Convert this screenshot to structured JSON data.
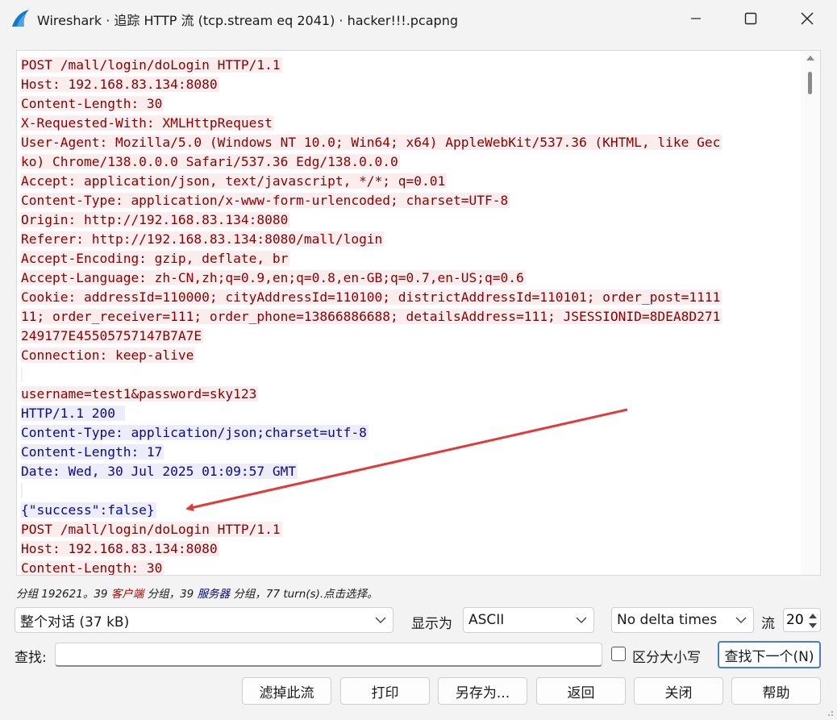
{
  "window": {
    "title": "Wireshark · 追踪 HTTP 流 (tcp.stream eq 2041) · hacker!!!.pcapng"
  },
  "stream_lines": [
    {
      "dir": "client",
      "text": "POST /mall/login/doLogin HTTP/1.1"
    },
    {
      "dir": "client",
      "text": "Host: 192.168.83.134:8080"
    },
    {
      "dir": "client",
      "text": "Content-Length: 30"
    },
    {
      "dir": "client",
      "text": "X-Requested-With: XMLHttpRequest"
    },
    {
      "dir": "client",
      "text": "User-Agent: Mozilla/5.0 (Windows NT 10.0; Win64; x64) AppleWebKit/537.36 (KHTML, like Gec"
    },
    {
      "dir": "client",
      "text": "ko) Chrome/138.0.0.0 Safari/537.36 Edg/138.0.0.0"
    },
    {
      "dir": "client",
      "text": "Accept: application/json, text/javascript, */*; q=0.01"
    },
    {
      "dir": "client",
      "text": "Content-Type: application/x-www-form-urlencoded; charset=UTF-8"
    },
    {
      "dir": "client",
      "text": "Origin: http://192.168.83.134:8080"
    },
    {
      "dir": "client",
      "text": "Referer: http://192.168.83.134:8080/mall/login"
    },
    {
      "dir": "client",
      "text": "Accept-Encoding: gzip, deflate, br"
    },
    {
      "dir": "client",
      "text": "Accept-Language: zh-CN,zh;q=0.9,en;q=0.8,en-GB;q=0.7,en-US;q=0.6"
    },
    {
      "dir": "client",
      "text": "Cookie: addressId=110000; cityAddressId=110100; districtAddressId=110101; order_post=1111"
    },
    {
      "dir": "client",
      "text": "11; order_receiver=111; order_phone=13866886688; detailsAddress=111; JSESSIONID=8DEA8D271"
    },
    {
      "dir": "client",
      "text": "249177E45505757147B7A7E"
    },
    {
      "dir": "client",
      "text": "Connection: keep-alive"
    },
    {
      "dir": "client",
      "text": ""
    },
    {
      "dir": "client",
      "text": "username=test1&password=sky123"
    },
    {
      "dir": "server",
      "text": "HTTP/1.1 200 "
    },
    {
      "dir": "server",
      "text": "Content-Type: application/json;charset=utf-8"
    },
    {
      "dir": "server",
      "text": "Content-Length: 17"
    },
    {
      "dir": "server",
      "text": "Date: Wed, 30 Jul 2025 01:09:57 GMT"
    },
    {
      "dir": "server",
      "text": ""
    },
    {
      "dir": "server",
      "text": "{\"success\":false}"
    },
    {
      "dir": "client",
      "text": "POST /mall/login/doLogin HTTP/1.1"
    },
    {
      "dir": "client",
      "text": "Host: 192.168.83.134:8080"
    },
    {
      "dir": "client",
      "text": "Content-Length: 30"
    }
  ],
  "colors": {
    "client_text": "#8b0000",
    "client_bg": "#fbeded",
    "server_text": "#0a0a8b",
    "server_bg": "#ececfb",
    "annotation_arrow": "#e03a3a"
  },
  "status": {
    "prefix": "分组 192621。39 ",
    "client_link": "客户端",
    "middle": " 分组，39 ",
    "server_link": "服务器",
    "suffix": " 分组，77 turn(s).点击选择。"
  },
  "controls": {
    "conversation_select": "整个对话 (37 kB)",
    "show_as_label": "显示为",
    "show_as_select": "ASCII",
    "delta_select": "No delta times",
    "stream_label": "流",
    "stream_value": "20",
    "find_label": "查找:",
    "find_value": "",
    "case_sensitive_label": "区分大小写",
    "find_next_button": "查找下一个(N)"
  },
  "buttons": {
    "filter_out": "滤掉此流",
    "print": "打印",
    "save_as": "另存为...",
    "back": "返回",
    "close": "关闭",
    "help": "帮助"
  }
}
